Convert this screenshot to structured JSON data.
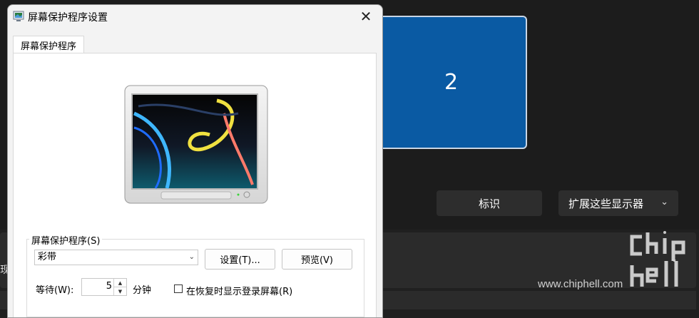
{
  "dialog": {
    "title": "屏幕保护程序设置",
    "tab_label": "屏幕保护程序",
    "group_label": "屏幕保护程序(S)",
    "screensaver_selected": "彩带",
    "settings_button": "设置(T)...",
    "preview_button": "预览(V)",
    "wait_label": "等待(W):",
    "wait_value": "5",
    "wait_unit": "分钟",
    "logon_checkbox_label": "在恢复时显示登录屏幕(R)",
    "logon_checked": false
  },
  "settings": {
    "monitor_label": "2",
    "identify_button": "标识",
    "display_mode": "扩展这些显示器",
    "left_cut_text": "现"
  },
  "watermark": {
    "text": "www.chiphell.com"
  },
  "icons": {
    "close": "close-icon",
    "chevron": "chevron-down-icon",
    "app": "screensaver-app-icon"
  },
  "colors": {
    "monitor_blue": "#0a5aa3",
    "dialog_bg": "#f3f3f3",
    "settings_bg": "#1c1c1c"
  }
}
